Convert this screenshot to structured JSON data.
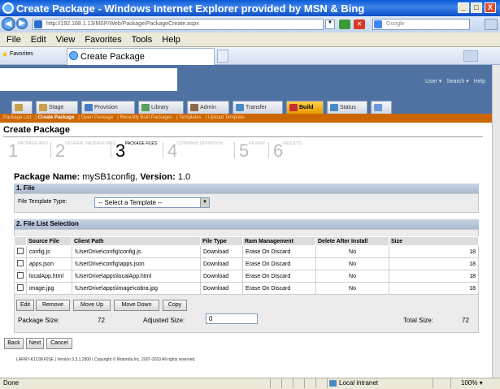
{
  "window": {
    "title": "Create Package - Windows Internet Explorer provided by MSN & Bing",
    "address": "http://192.168.1.13/MSP/Web/Package/PackageCreate.aspx",
    "search_placeholder": "Google",
    "min_label": "_",
    "max_label": "□",
    "close_label": "X"
  },
  "menu": [
    "File",
    "Edit",
    "View",
    "Favorites",
    "Tools",
    "Help"
  ],
  "favorites_label": "Favorites",
  "tab_title": "Create Package",
  "header": {
    "user": "User",
    "search": "Search",
    "help": "Help"
  },
  "nav_tabs": [
    {
      "label": ""
    },
    {
      "label": "Stage"
    },
    {
      "label": "Provision"
    },
    {
      "label": "Library"
    },
    {
      "label": "Admin"
    },
    {
      "label": "Transfer"
    },
    {
      "label": "Build"
    },
    {
      "label": "Status"
    },
    {
      "label": ""
    }
  ],
  "subnav": [
    "Package List",
    "Create Package",
    "Open Package",
    "Recently Built Packages",
    "Templates",
    "Upload Template"
  ],
  "page_title": "Create Package",
  "steps": [
    {
      "n": "1",
      "label": "PACKAGE INFO"
    },
    {
      "n": "2",
      "label": "GENERAL PACKAGE INFO"
    },
    {
      "n": "3",
      "label": "PACKAGE FILES"
    },
    {
      "n": "4",
      "label": "COMMAND DEFINITION"
    },
    {
      "n": "5",
      "label": "REVIEW"
    },
    {
      "n": "6",
      "label": "RESULTS"
    }
  ],
  "package": {
    "name_label": "Package Name:",
    "name": "mySB1config,",
    "version_label": "Version:",
    "version": "1.0"
  },
  "file_section": {
    "header": "1. File",
    "template_label": "File Template Type:",
    "template_value": "-- Select a Template --"
  },
  "list_section": {
    "header": "2. File List Selection",
    "columns": [
      "",
      "Source File",
      "Client Path",
      "File Type",
      "Ram Management",
      "Delete After Install",
      "Size"
    ],
    "rows": [
      {
        "source": "config.js",
        "path": "\\UserDrive\\config\\config.js",
        "type": "Download",
        "ram": "Erase On Discard",
        "delete": "No",
        "size": "18"
      },
      {
        "source": "apps.json",
        "path": "\\UserDrive\\config\\apps.json",
        "type": "Download",
        "ram": "Erase On Discard",
        "delete": "No",
        "size": "18"
      },
      {
        "source": "localApp.html",
        "path": "\\UserDrive\\apps\\localApp.html",
        "type": "Download",
        "ram": "Erase On Discard",
        "delete": "No",
        "size": "18"
      },
      {
        "source": "image.jpg",
        "path": "\\UserDrive\\apps\\image\\cobra.jpg",
        "type": "Download",
        "ram": "Erase On Discard",
        "delete": "No",
        "size": "18"
      }
    ],
    "buttons": [
      "Edit",
      "Remove",
      "Move Up",
      "Move Down",
      "Copy"
    ],
    "package_size_label": "Package Size:",
    "package_size": "72",
    "adjusted_size_label": "Adjusted Size:",
    "adjusted_size": "0",
    "total_size_label": "Total Size:",
    "total_size": "72"
  },
  "nav_buttons": [
    "Back",
    "Next",
    "Cancel"
  ],
  "footer": "LARRY-K1C0KF0SE | Version 3.3.1.2800 | Copyright © Motorola Inc. 2007-2010 All rights reserved.",
  "status": {
    "left": "Done",
    "zone": "Local intranet",
    "zoom": "100%"
  }
}
